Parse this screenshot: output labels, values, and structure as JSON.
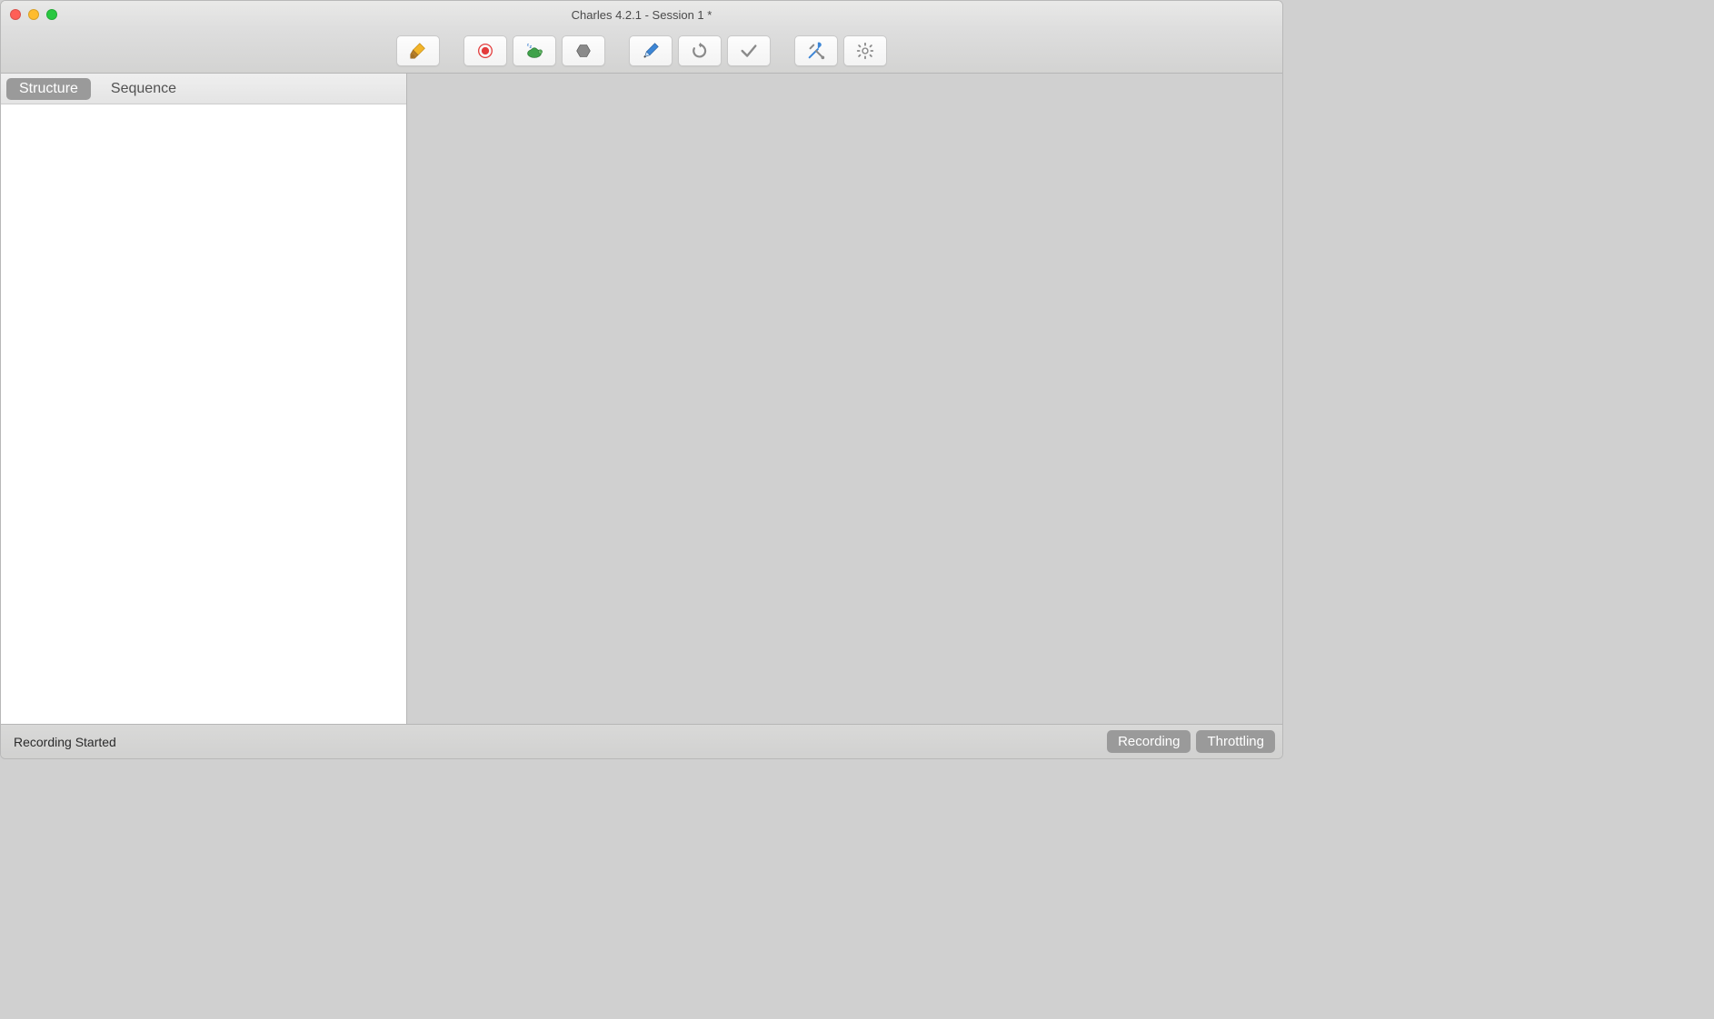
{
  "window": {
    "title": "Charles 4.2.1 - Session 1 *"
  },
  "toolbar": {
    "icons": {
      "broom": "broom-icon",
      "record": "record-icon",
      "throttle": "turtle-icon",
      "breakpoints": "hexagon-icon",
      "compose": "pen-icon",
      "repeat": "repeat-icon",
      "validate": "check-icon",
      "tools": "tools-icon",
      "settings": "gear-icon"
    }
  },
  "tabs": {
    "structure": "Structure",
    "sequence": "Sequence",
    "active": "structure"
  },
  "status": {
    "message": "Recording Started",
    "recording_label": "Recording",
    "throttling_label": "Throttling"
  }
}
